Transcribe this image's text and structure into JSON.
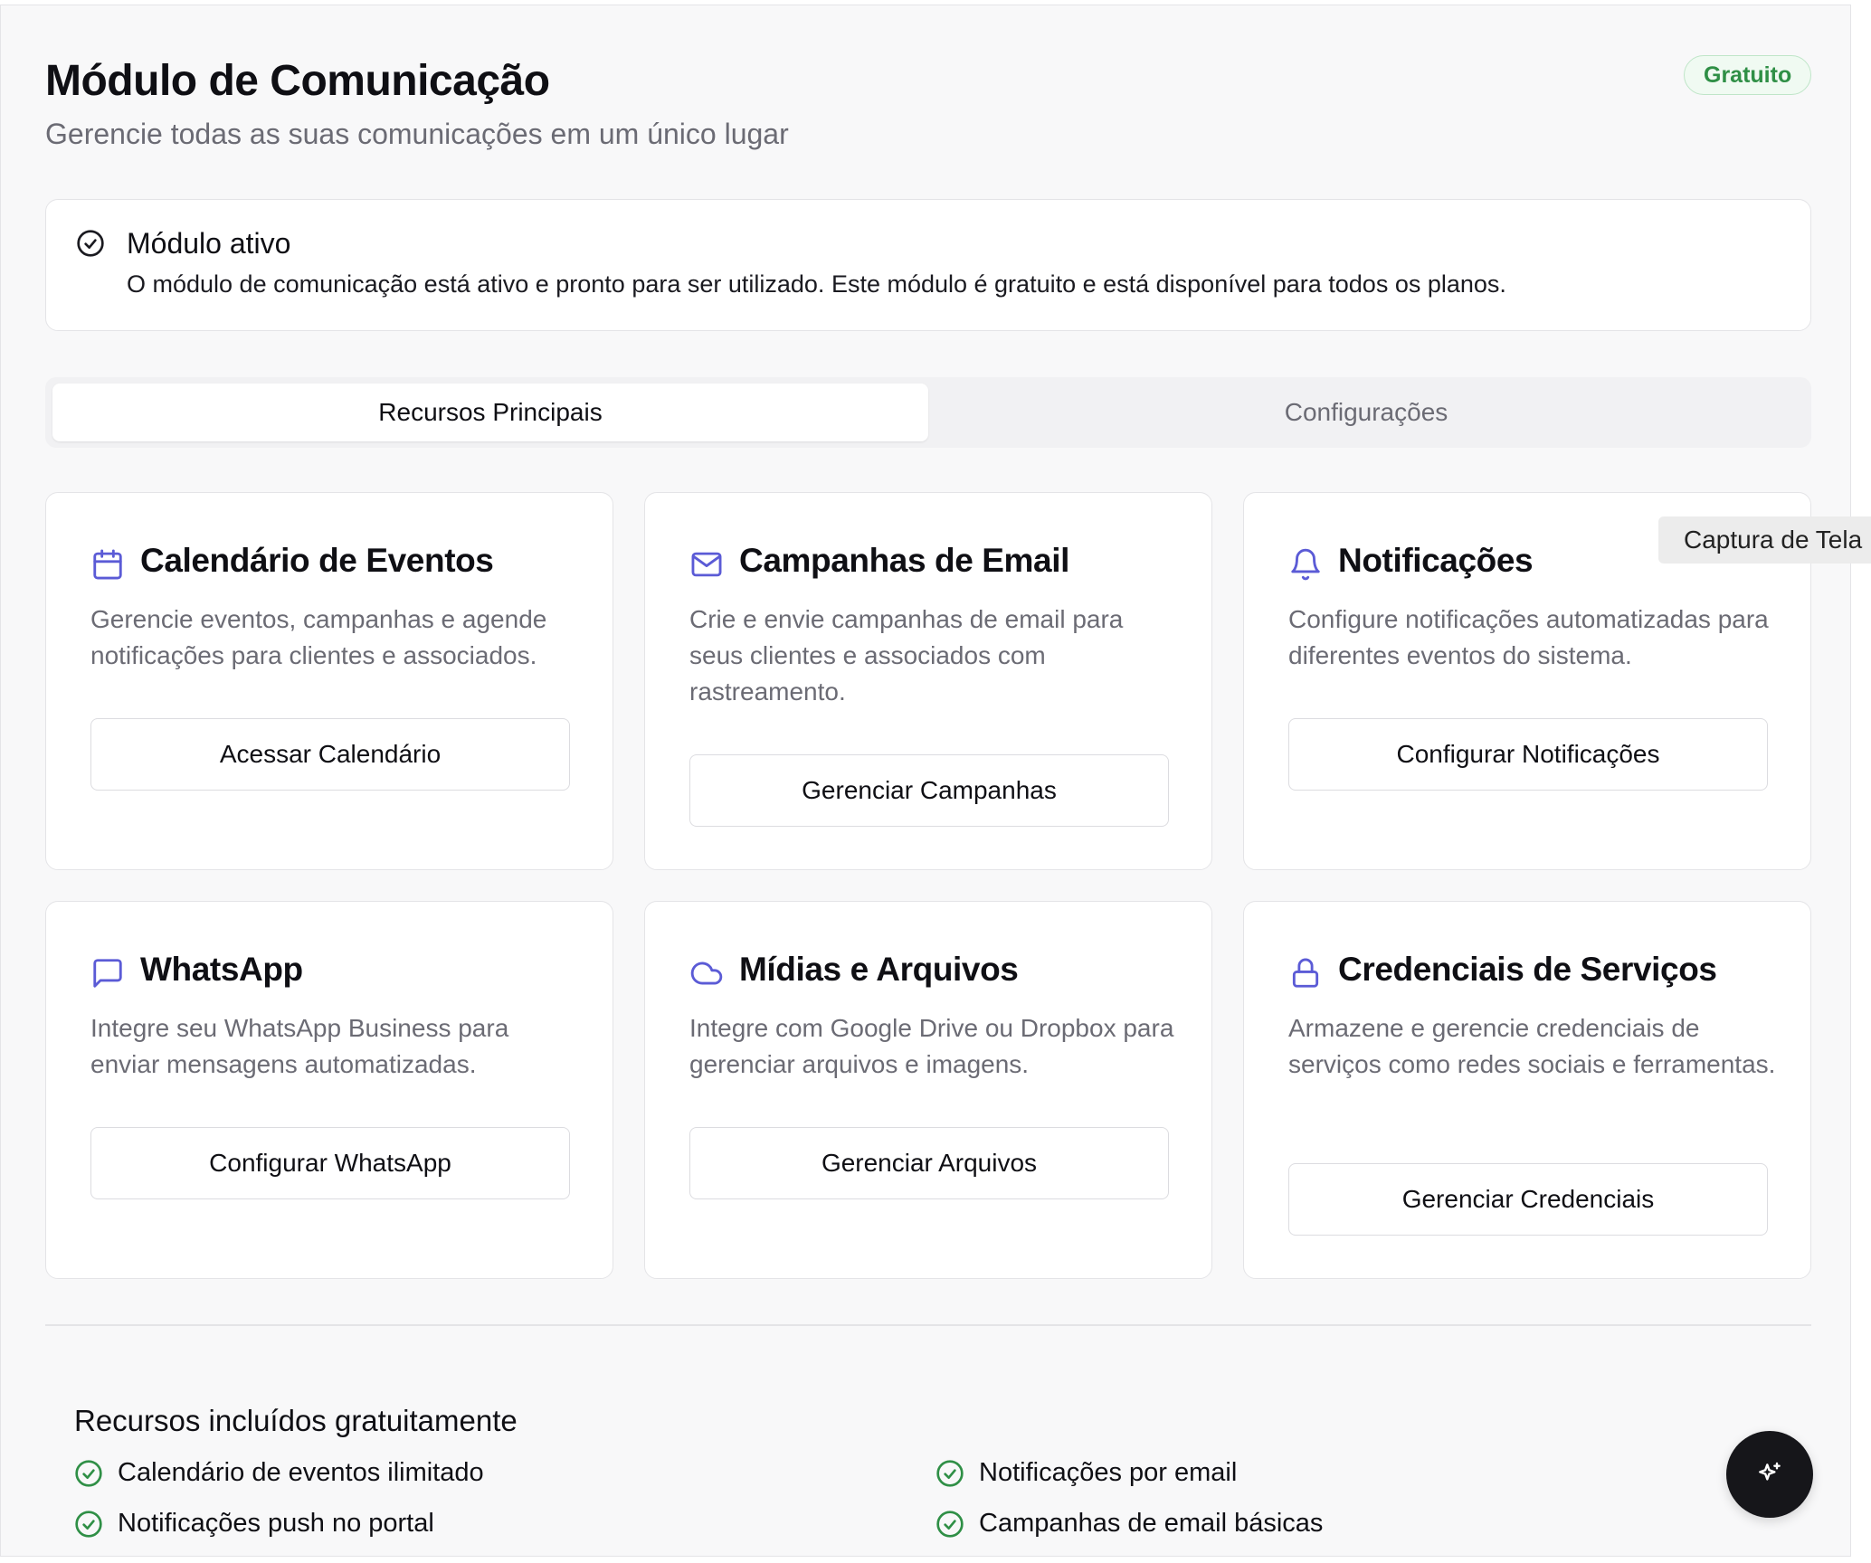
{
  "header": {
    "title": "Módulo de Comunicação",
    "subtitle": "Gerencie todas as suas comunicações em um único lugar",
    "badge": "Gratuito"
  },
  "alert": {
    "icon": "check-circle-icon",
    "title": "Módulo ativo",
    "text": "O módulo de comunicação está ativo e pronto para ser utilizado. Este módulo é gratuito e está disponível para todos os planos."
  },
  "tabs": [
    {
      "label": "Recursos Principais",
      "active": true
    },
    {
      "label": "Configurações",
      "active": false
    }
  ],
  "cards": [
    {
      "icon": "calendar-icon",
      "title": "Calendário de Eventos",
      "description": "Gerencie eventos, campanhas e agende notificações para clientes e associados.",
      "button": "Acessar Calendário"
    },
    {
      "icon": "mail-icon",
      "title": "Campanhas de Email",
      "description": "Crie e envie campanhas de email para seus clientes e associados com rastreamento.",
      "button": "Gerenciar Campanhas"
    },
    {
      "icon": "bell-icon",
      "title": "Notificações",
      "description": "Configure notificações automatizadas para diferentes eventos do sistema.",
      "button": "Configurar Notificações"
    },
    {
      "icon": "message-square-icon",
      "title": "WhatsApp",
      "description": "Integre seu WhatsApp Business para enviar mensagens automatizadas.",
      "button": "Configurar WhatsApp"
    },
    {
      "icon": "cloud-icon",
      "title": "Mídias e Arquivos",
      "description": "Integre com Google Drive ou Dropbox para gerenciar arquivos e imagens.",
      "button": "Gerenciar Arquivos"
    },
    {
      "icon": "lock-icon",
      "title": "Credenciais de Serviços",
      "description": "Armazene e gerencie credenciais de serviços como redes sociais e ferramentas.",
      "button": "Gerenciar Credenciais"
    }
  ],
  "included": {
    "title": "Recursos incluídos gratuitamente",
    "items": [
      "Calendário de eventos ilimitado",
      "Notificações por email",
      "Notificações push no portal",
      "Campanhas de email básicas"
    ]
  },
  "tooltip": "Captura de Tela",
  "fab_icon": "sparkles-icon",
  "colors": {
    "accent": "#5b5bd6",
    "success": "#2f8f46",
    "background": "#f8f8f9"
  }
}
